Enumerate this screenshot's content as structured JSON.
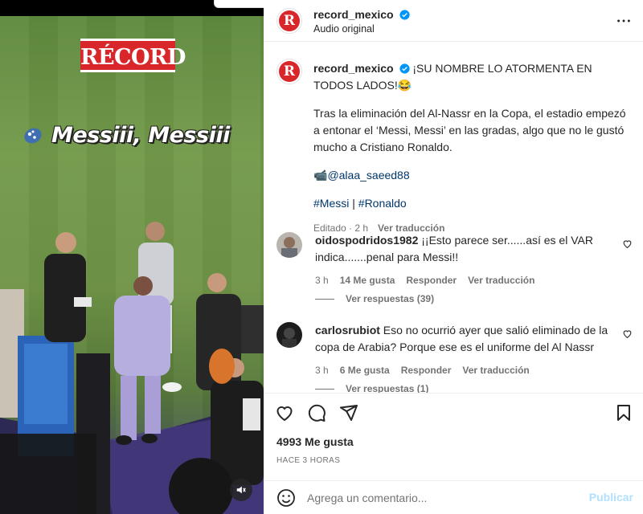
{
  "video": {
    "brand_label": "RÉCORD",
    "overlay_text": "Messiii, Messiii",
    "icons": {
      "emoji": "speaker-emoji-icon",
      "audio": "speaker-muted-icon"
    }
  },
  "header": {
    "username": "record_mexico",
    "subtitle": "Audio original",
    "avatar_letter": "R",
    "verified": true,
    "colors": {
      "brand_red": "#d8262b",
      "verified_blue": "#0095f6"
    }
  },
  "caption": {
    "username": "record_mexico",
    "headline": "¡SU NOMBRE LO ATORMENTA EN TODOS LADOS!😂",
    "body": "Tras la eliminación del Al-Nassr en la Copa, el estadio empezó a entonar el ‘Messi, Messi’ en las gradas, algo que no le gustó mucho a Cristiano Ronaldo.",
    "credit_icon": "📹",
    "credit": "@alaa_saeed88",
    "tag1": "#Messi",
    "tag_separator": " | ",
    "tag2": "#Ronaldo",
    "edited": "Editado · 2 h",
    "translate": "Ver traducción"
  },
  "comments": [
    {
      "username": "oidospodridos1982",
      "text": "¡¡Esto parece ser......así es el VAR indica.......penal para Messi!!",
      "time": "3 h",
      "likes": "14 Me gusta",
      "reply": "Responder",
      "translate": "Ver traducción",
      "view_replies": "Ver respuestas (39)"
    },
    {
      "username": "carlosrubiot",
      "text": "Eso no ocurrió ayer que salió eliminado de la copa de Arabia? Porque ese es el uniforme del Al Nassr",
      "time": "3 h",
      "likes": "6 Me gusta",
      "reply": "Responder",
      "translate": "Ver traducción",
      "view_replies": "Ver respuestas (1)"
    }
  ],
  "actions": {
    "likes": "4993 Me gusta",
    "time_ago": "HACE 3 HORAS"
  },
  "add_comment": {
    "placeholder": "Agrega un comentario...",
    "post_label": "Publicar"
  }
}
